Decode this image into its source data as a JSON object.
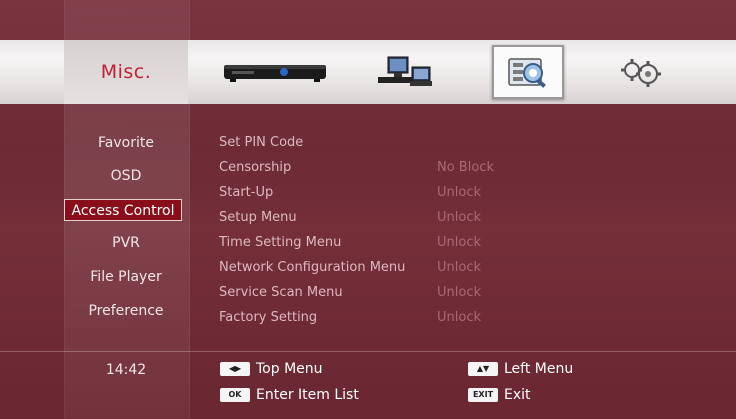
{
  "header": {
    "title": "Misc.",
    "icons": [
      {
        "name": "set-top-box-icon",
        "selected": false
      },
      {
        "name": "network-computer-icon",
        "selected": false
      },
      {
        "name": "misc-settings-icon",
        "selected": true
      },
      {
        "name": "gears-icon",
        "selected": false
      }
    ]
  },
  "sidebar": {
    "items": [
      {
        "label": "Favorite"
      },
      {
        "label": "OSD"
      },
      {
        "label": "Access Control",
        "active": true
      },
      {
        "label": "PVR"
      },
      {
        "label": "File Player"
      },
      {
        "label": "Preference"
      }
    ]
  },
  "options": [
    {
      "label": "Set PIN Code",
      "value": ""
    },
    {
      "label": "Censorship",
      "value": "No Block"
    },
    {
      "label": "Start-Up",
      "value": "Unlock"
    },
    {
      "label": "Setup Menu",
      "value": "Unlock"
    },
    {
      "label": "Time Setting Menu",
      "value": "Unlock"
    },
    {
      "label": "Network Configuration Menu",
      "value": "Unlock"
    },
    {
      "label": "Service Scan Menu",
      "value": "Unlock"
    },
    {
      "label": "Factory Setting",
      "value": "Unlock"
    }
  ],
  "footer": {
    "time": "14:42",
    "hints": [
      {
        "key": "◀▶",
        "label": "Top Menu"
      },
      {
        "key": "▲▼",
        "label": "Left Menu"
      },
      {
        "key": "OK",
        "label": "Enter Item List"
      },
      {
        "key": "EXIT",
        "label": "Exit"
      }
    ]
  },
  "colors": {
    "background": "#6d2b35",
    "accent": "#8a0e19",
    "title": "#c02035"
  }
}
